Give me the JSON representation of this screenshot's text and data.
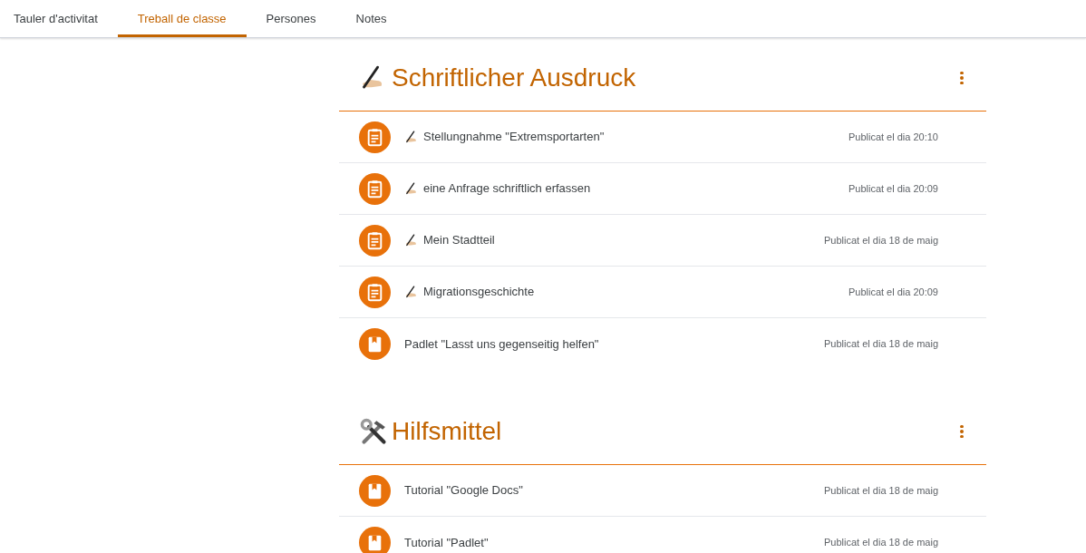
{
  "tabs": [
    {
      "label": "Tauler d'activitat",
      "selected": false
    },
    {
      "label": "Treball de classe",
      "selected": true
    },
    {
      "label": "Persones",
      "selected": false
    },
    {
      "label": "Notes",
      "selected": false
    }
  ],
  "topics": [
    {
      "kind": "writing",
      "title": "Schriftlicher Ausdruck",
      "items": [
        {
          "kind": "assignment",
          "writing_prefix": true,
          "title": "Stellungnahme \"Extremsportarten\"",
          "date": "Publicat el dia 20:10"
        },
        {
          "kind": "assignment",
          "writing_prefix": true,
          "title": "eine Anfrage schriftlich erfassen",
          "date": "Publicat el dia 20:09"
        },
        {
          "kind": "assignment",
          "writing_prefix": true,
          "title": "Mein Stadtteil",
          "date": "Publicat el dia 18 de maig"
        },
        {
          "kind": "assignment",
          "writing_prefix": true,
          "title": "Migrationsgeschichte",
          "date": "Publicat el dia 20:09"
        },
        {
          "kind": "material",
          "writing_prefix": false,
          "title": "Padlet \"Lasst uns gegenseitig helfen\"",
          "date": "Publicat el dia 18 de maig"
        }
      ]
    },
    {
      "kind": "tools",
      "title": "Hilfsmittel",
      "items": [
        {
          "kind": "material",
          "writing_prefix": false,
          "title": "Tutorial \"Google Docs\"",
          "date": "Publicat el dia 18 de maig"
        },
        {
          "kind": "material",
          "writing_prefix": false,
          "title": "Tutorial \"Padlet\"",
          "date": "Publicat el dia 18 de maig"
        }
      ]
    }
  ]
}
